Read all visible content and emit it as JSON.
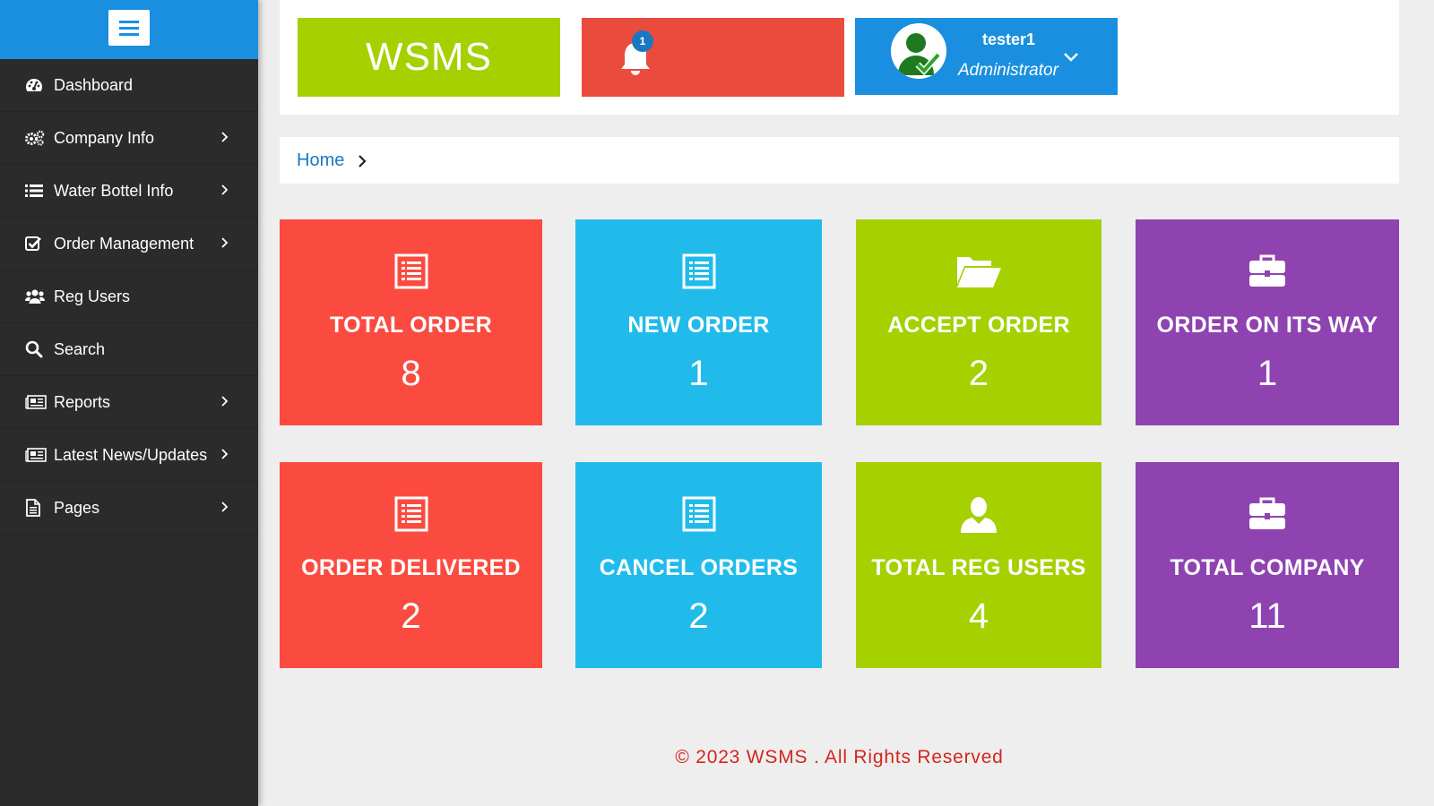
{
  "sidebar": {
    "items": [
      {
        "label": "Dashboard",
        "icon": "dashboard-icon",
        "has_submenu": false
      },
      {
        "label": "Company Info",
        "icon": "gears-icon",
        "has_submenu": true
      },
      {
        "label": "Water Bottel Info",
        "icon": "list-icon",
        "has_submenu": true
      },
      {
        "label": "Order Management",
        "icon": "check-square-icon",
        "has_submenu": true
      },
      {
        "label": "Reg Users",
        "icon": "users-icon",
        "has_submenu": false
      },
      {
        "label": "Search",
        "icon": "search-icon",
        "has_submenu": false
      },
      {
        "label": "Reports",
        "icon": "newspaper-icon",
        "has_submenu": true
      },
      {
        "label": "Latest News/Updates",
        "icon": "newspaper-icon",
        "has_submenu": true
      },
      {
        "label": "Pages",
        "icon": "file-icon",
        "has_submenu": true
      }
    ]
  },
  "header": {
    "brand": "WSMS",
    "notification_count": "1",
    "user": {
      "name": "tester1",
      "role": "Administrator"
    }
  },
  "breadcrumb": {
    "home": "Home"
  },
  "cards": [
    {
      "title": "TOTAL ORDER",
      "value": "8",
      "color": "#fb4b40",
      "icon": "list-alt-icon"
    },
    {
      "title": "NEW ORDER",
      "value": "1",
      "color": "#21bbeb",
      "icon": "list-alt-icon"
    },
    {
      "title": "ACCEPT ORDER",
      "value": "2",
      "color": "#a6d000",
      "icon": "folder-open-icon"
    },
    {
      "title": "ORDER ON ITS WAY",
      "value": "1",
      "color": "#8e43b0",
      "icon": "briefcase-icon"
    },
    {
      "title": "ORDER DELIVERED",
      "value": "2",
      "color": "#fb4b40",
      "icon": "list-alt-icon"
    },
    {
      "title": "CANCEL ORDERS",
      "value": "2",
      "color": "#21bbeb",
      "icon": "list-alt-icon"
    },
    {
      "title": "TOTAL REG USERS",
      "value": "4",
      "color": "#a6d000",
      "icon": "user-icon"
    },
    {
      "title": "TOTAL COMPANY",
      "value": "11",
      "color": "#8e43b0",
      "icon": "briefcase-icon"
    }
  ],
  "footer": {
    "text": "© 2023 WSMS . All Rights Reserved"
  },
  "colors": {
    "sidebar_bg": "#2b2b2b",
    "primary_blue": "#1a8fdf",
    "link_blue": "#1a78c2",
    "footer_red": "#d0271e"
  }
}
